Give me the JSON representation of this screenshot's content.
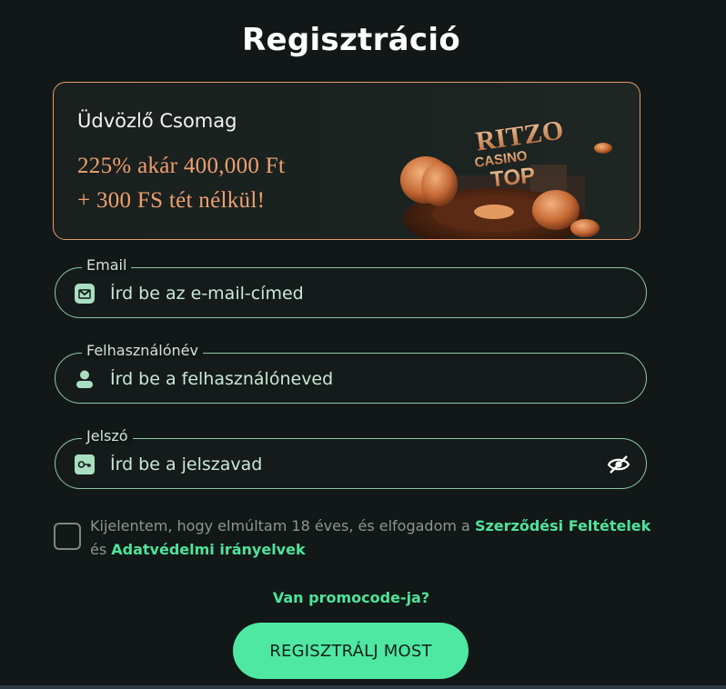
{
  "page": {
    "title": "Regisztráció"
  },
  "bonus": {
    "title": "Üdvözlő Csomag",
    "offer_line1": "225% akár 400,000 Ft",
    "offer_line2": "+ 300 FS tét nélkül!",
    "art_text": [
      "RITZO",
      "CASINO",
      "TOP"
    ]
  },
  "form": {
    "email": {
      "label": "Email",
      "placeholder": "Írd be az e-mail-címed",
      "icon": "envelope-icon"
    },
    "username": {
      "label": "Felhasználónév",
      "placeholder": "Írd be a felhasználóneved",
      "icon": "user-icon"
    },
    "password": {
      "label": "Jelszó",
      "placeholder": "Írd be a jelszavad",
      "icon": "key-icon",
      "toggle_icon": "eye-slash-icon"
    }
  },
  "consent": {
    "text_before": "Kijelentem, hogy elmúltam 18 éves, és elfogadom a ",
    "terms_link": "Szerződési Feltételek",
    "text_middle": " és ",
    "privacy_link": "Adatvédelmi irányelvek"
  },
  "promo_link": "Van promocode-ja?",
  "cta_label": "REGISZTRÁLJ MOST",
  "colors": {
    "background": "#121817",
    "accent": "#4fe39b",
    "bonus_border": "#e59a6b",
    "bonus_text": "#f0a070",
    "field_border": "#8ec7a6"
  }
}
